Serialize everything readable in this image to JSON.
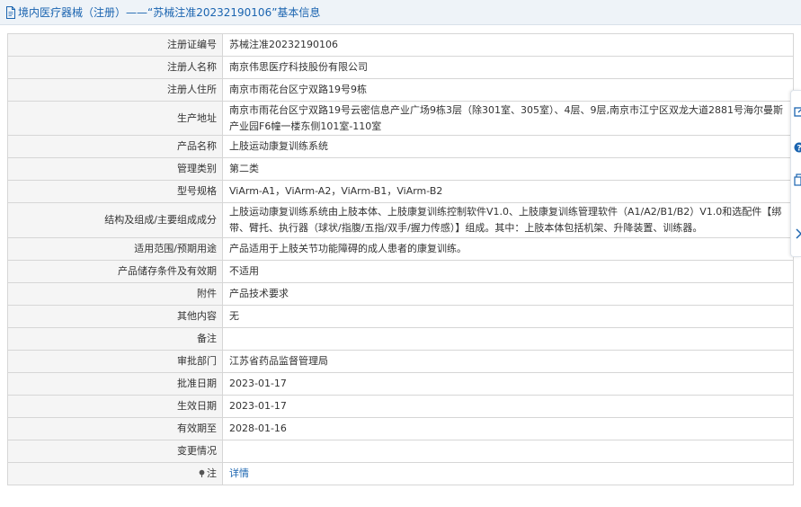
{
  "header": {
    "title": "境内医疗器械（注册）——“苏械注准20232190106”基本信息"
  },
  "colors": {
    "accent": "#1a64b0",
    "label_bg": "#f5f5f5",
    "border": "#d6d6d6",
    "header_bg": "#eef3f8"
  },
  "icons": {
    "header": "document-icon",
    "note": "pin-icon",
    "side_tools": [
      "external-link-icon",
      "help-icon",
      "copy-icon",
      "chevron-right-icon"
    ]
  },
  "rows": [
    {
      "label": "注册证编号",
      "value": "苏械注准20232190106"
    },
    {
      "label": "注册人名称",
      "value": "南京伟思医疗科技股份有限公司"
    },
    {
      "label": "注册人住所",
      "value": "南京市雨花台区宁双路19号9栋"
    },
    {
      "label": "生产地址",
      "value": "南京市雨花台区宁双路19号云密信息产业广场9栋3层（除301室、305室）、4层、9层,南京市江宁区双龙大道2881号海尔曼斯产业园F6幢一楼东侧101室-110室"
    },
    {
      "label": "产品名称",
      "value": "上肢运动康复训练系统"
    },
    {
      "label": "管理类别",
      "value": "第二类"
    },
    {
      "label": "型号规格",
      "value": "ViArm-A1，ViArm-A2，ViArm-B1，ViArm-B2"
    },
    {
      "label": "结构及组成/主要组成成分",
      "value": "上肢运动康复训练系统由上肢本体、上肢康复训练控制软件V1.0、上肢康复训练管理软件（A1/A2/B1/B2）V1.0和选配件【绑带、臂托、执行器（球状/指腹/五指/双手/握力传感）】组成。其中：上肢本体包括机架、升降装置、训练器。"
    },
    {
      "label": "适用范围/预期用途",
      "value": "产品适用于上肢关节功能障碍的成人患者的康复训练。"
    },
    {
      "label": "产品储存条件及有效期",
      "value": "不适用"
    },
    {
      "label": "附件",
      "value": "产品技术要求"
    },
    {
      "label": "其他内容",
      "value": "无"
    },
    {
      "label": "备注",
      "value": ""
    },
    {
      "label": "审批部门",
      "value": "江苏省药品监督管理局"
    },
    {
      "label": "批准日期",
      "value": "2023-01-17"
    },
    {
      "label": "生效日期",
      "value": "2023-01-17"
    },
    {
      "label": "有效期至",
      "value": "2028-01-16"
    },
    {
      "label": "变更情况",
      "value": ""
    }
  ],
  "note": {
    "label": "注",
    "link": "详情"
  }
}
